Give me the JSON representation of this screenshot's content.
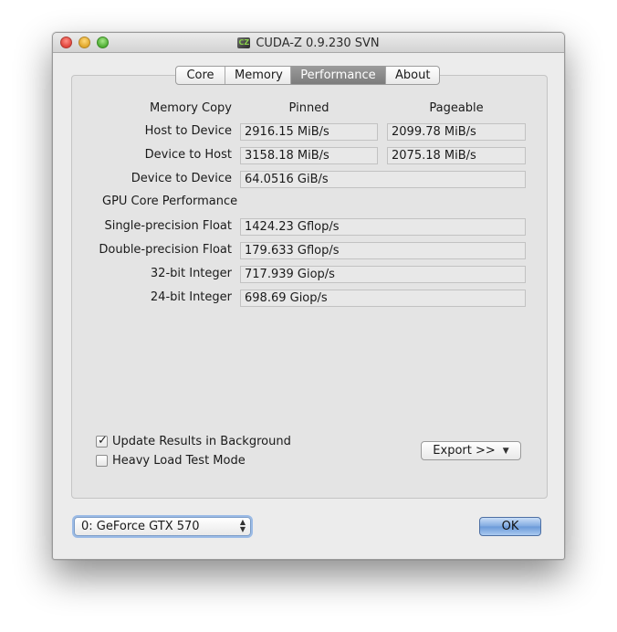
{
  "window": {
    "title": "CUDA-Z 0.9.230 SVN",
    "app_icon_text": "CZ"
  },
  "tabs": [
    {
      "label": "Core"
    },
    {
      "label": "Memory"
    },
    {
      "label": "Performance"
    },
    {
      "label": "About"
    }
  ],
  "performance": {
    "memory_copy_header": "Memory Copy",
    "pinned_header": "Pinned",
    "pageable_header": "Pageable",
    "host_to_device": {
      "label": "Host to Device",
      "pinned": "2916.15 MiB/s",
      "pageable": "2099.78 MiB/s"
    },
    "device_to_host": {
      "label": "Device to Host",
      "pinned": "3158.18 MiB/s",
      "pageable": "2075.18 MiB/s"
    },
    "device_to_device": {
      "label": "Device to Device",
      "value": "64.0516 GiB/s"
    },
    "gpu_core_header": "GPU Core Performance",
    "single_precision": {
      "label": "Single-precision Float",
      "value": "1424.23 Gflop/s"
    },
    "double_precision": {
      "label": "Double-precision Float",
      "value": "179.633 Gflop/s"
    },
    "int32": {
      "label": "32-bit Integer",
      "value": "717.939 Giop/s"
    },
    "int24": {
      "label": "24-bit Integer",
      "value": "698.69 Giop/s"
    }
  },
  "options": {
    "update_background": {
      "label": "Update Results in Background",
      "checked": true,
      "mark": "✓"
    },
    "heavy_load": {
      "label": "Heavy Load Test Mode",
      "checked": false
    }
  },
  "export_button": {
    "label": "Export >>",
    "arrow": "▼"
  },
  "device_select": {
    "value": "0: GeForce GTX 570",
    "arrows_up": "▲",
    "arrows_down": "▼"
  },
  "ok_button": {
    "label": "OK"
  }
}
